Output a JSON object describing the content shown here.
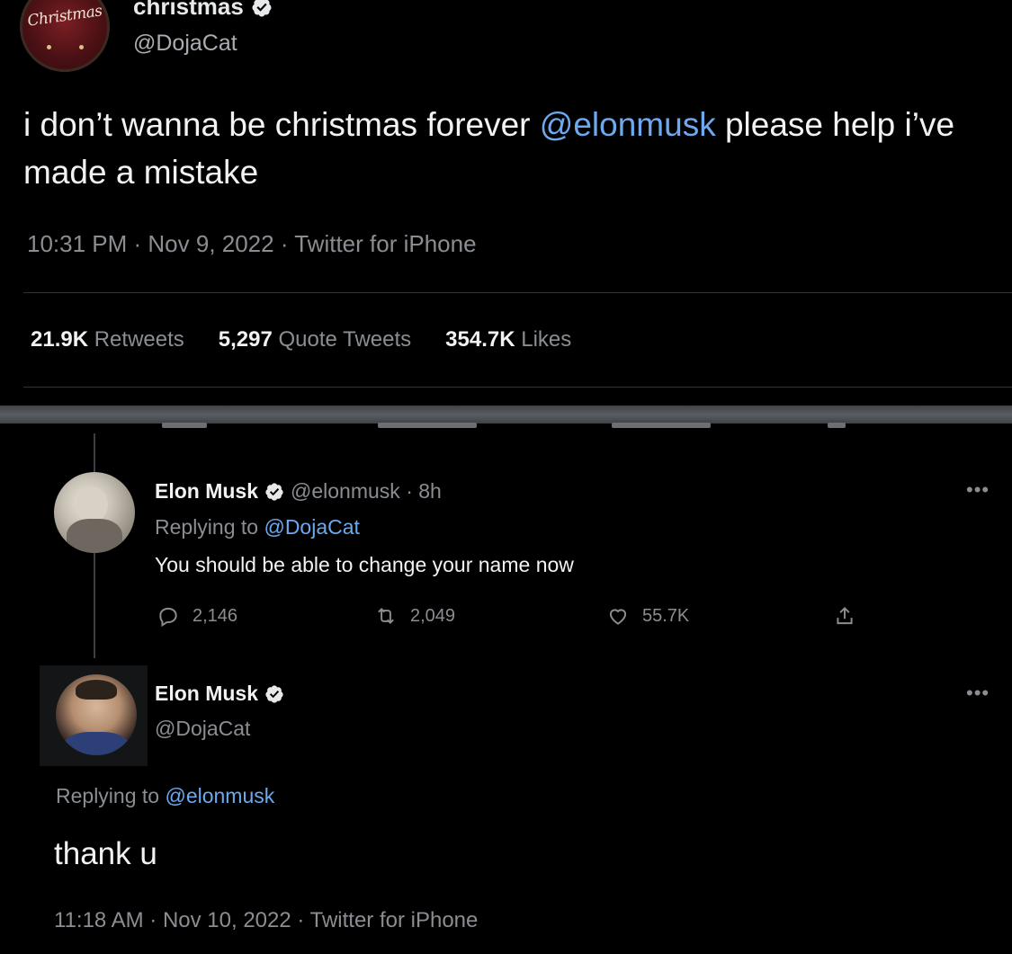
{
  "main_tweet": {
    "avatar_text": "Christmas",
    "display_name": "christmas",
    "handle": "@DojaCat",
    "text_before": "i don’t wanna be christmas forever ",
    "mention": "@elonmusk",
    "text_after": " please help i’ve made a mistake",
    "timestamp": "10:31 PM · Nov 9, 2022 · Twitter for iPhone",
    "stats": {
      "retweets_count": "21.9K",
      "retweets_label": "Retweets",
      "quotes_count": "5,297",
      "quotes_label": "Quote Tweets",
      "likes_count": "354.7K",
      "likes_label": "Likes"
    }
  },
  "reply1": {
    "display_name": "Elon Musk",
    "handle_time": "@elonmusk · 8h",
    "replying_prefix": "Replying to",
    "replying_to": "@DojaCat",
    "text": "You should be able to change your name now",
    "more_icon": "more-icon",
    "actions": {
      "replies": "2,146",
      "retweets": "2,049",
      "likes": "55.7K"
    }
  },
  "reply2": {
    "display_name": "Elon Musk",
    "handle": "@DojaCat",
    "more_icon": "more-icon",
    "replying_prefix": "Replying to",
    "replying_to": "@elonmusk",
    "text": "thank u",
    "timestamp": "11:18 AM · Nov 10, 2022 · Twitter for iPhone"
  },
  "colors": {
    "background": "#000000",
    "link": "#6ca9ee",
    "muted": "#8a8e92",
    "verified": "#e7e9ea"
  }
}
